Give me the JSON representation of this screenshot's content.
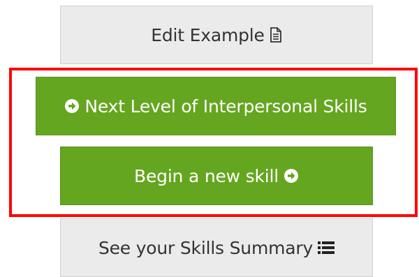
{
  "buttons": {
    "edit_example": {
      "label": "Edit Example",
      "icon": "document-icon"
    },
    "next_level": {
      "label": "Next Level of Interpersonal Skills",
      "icon": "circle-arrow-right-icon"
    },
    "begin_new_skill": {
      "label": "Begin a new skill",
      "icon": "circle-arrow-right-icon"
    },
    "skills_summary": {
      "label": "See your Skills Summary",
      "icon": "list-icon"
    }
  },
  "colors": {
    "green_button": "#64a61f",
    "gray_button": "#ebebeb",
    "highlight_border": "#ff0000"
  }
}
